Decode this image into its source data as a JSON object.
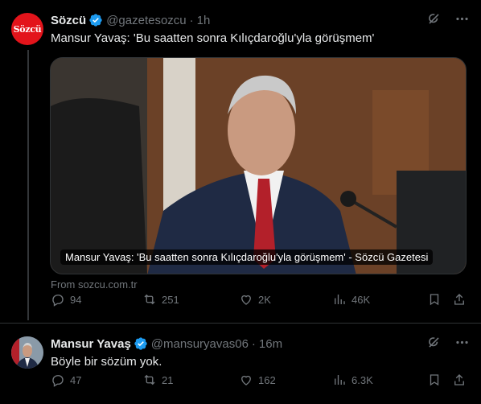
{
  "tweets": [
    {
      "author_name": "Sözcü",
      "handle": "@gazetesozcu",
      "separator": "·",
      "time": "1h",
      "avatar_text": "Sözcü",
      "text": "Mansur Yavaş: 'Bu saatten sonra Kılıçdaroğlu'yla görüşmem'",
      "card_caption": "Mansur Yavaş: 'Bu saatten sonra Kılıçdaroğlu'yla görüşmem' - Sözcü Gazetesi",
      "card_source": "From sozcu.com.tr",
      "stats": {
        "replies": "94",
        "retweets": "251",
        "likes": "2K",
        "views": "46K"
      }
    },
    {
      "author_name": "Mansur Yavaş",
      "handle": "@mansuryavas06",
      "separator": "·",
      "time": "16m",
      "text": "Böyle bir sözüm yok.",
      "stats": {
        "replies": "47",
        "retweets": "21",
        "likes": "162",
        "views": "6.3K"
      }
    }
  ],
  "colors": {
    "background": "#000000",
    "text": "#e7e9ea",
    "muted": "#71767b",
    "verified": "#1d9bf0",
    "sozcu_red": "#e3141b"
  },
  "icons": [
    "verified-badge-icon",
    "grok-icon",
    "more-icon",
    "reply-icon",
    "retweet-icon",
    "like-icon",
    "views-icon",
    "bookmark-icon",
    "share-icon"
  ]
}
